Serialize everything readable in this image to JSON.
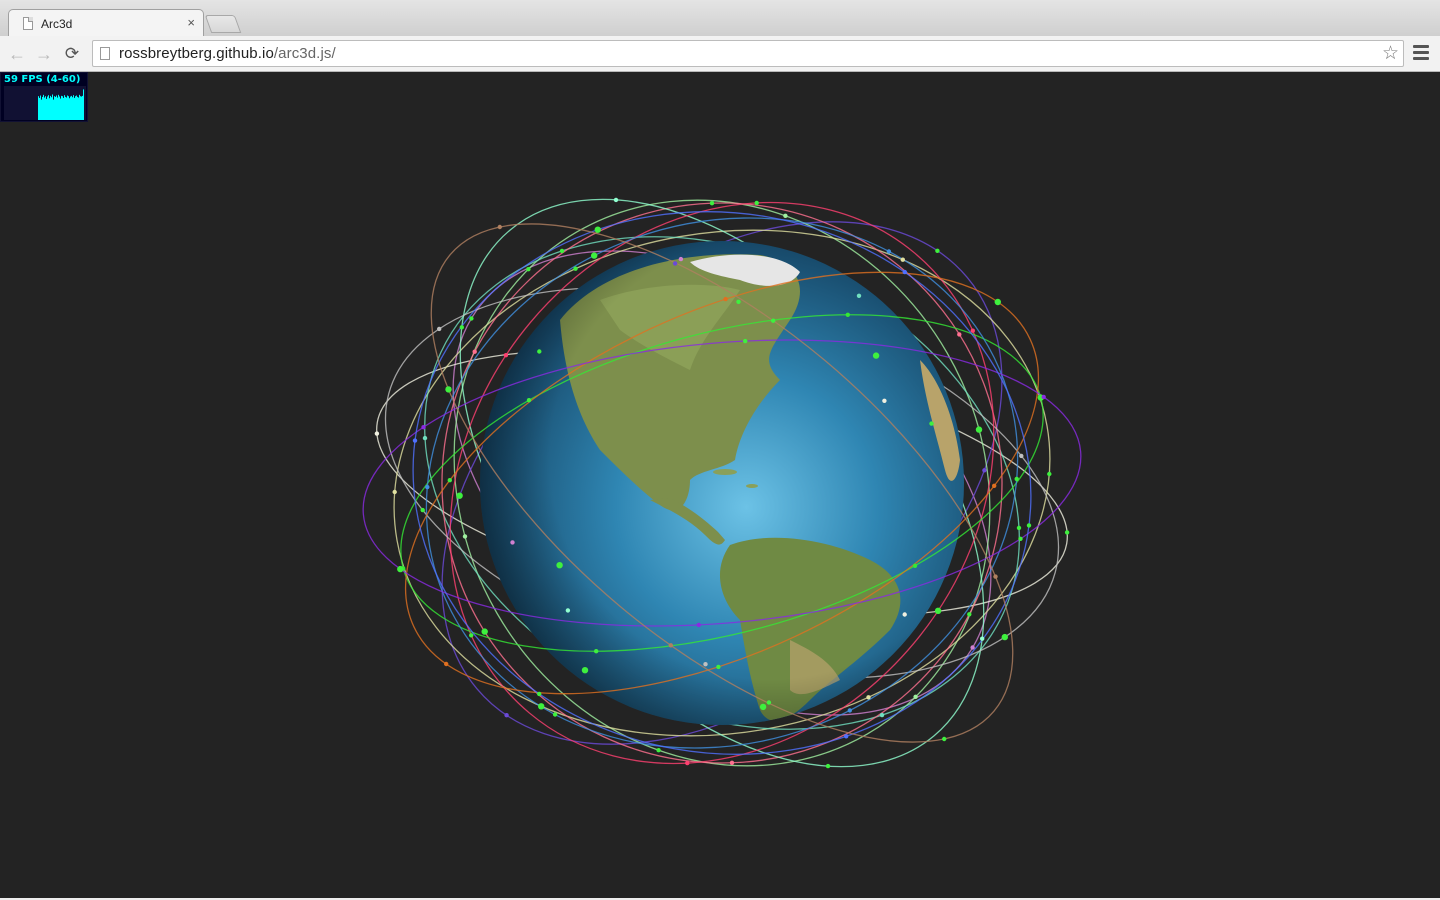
{
  "tab": {
    "title": "Arc3d",
    "close_label": "×",
    "icon": "document-icon"
  },
  "toolbar": {
    "back_label": "←",
    "forward_label": "→",
    "reload_label": "⟳",
    "url_host": "rossbreytberg.github.io",
    "url_path": "/arc3d.js/",
    "bookmark_label": "☆"
  },
  "stats": {
    "fps_text": "59 FPS (4-60)",
    "bars": [
      0.7,
      0.65,
      0.72,
      0.6,
      0.68,
      0.74,
      0.66,
      0.7,
      0.62,
      0.69,
      0.73,
      0.64,
      0.71,
      0.67,
      0.75,
      0.6,
      0.7,
      0.68,
      0.72,
      0.66,
      0.74,
      0.69,
      0.63,
      0.71,
      0.7,
      0.65,
      0.73,
      0.68,
      0.66,
      0.72,
      0.7,
      0.64,
      0.69,
      0.71,
      0.67,
      0.73,
      0.65,
      0.7,
      0.72,
      0.68,
      0.66,
      0.74,
      0.7,
      0.69,
      0.71,
      0.9
    ]
  },
  "scene": {
    "background": "#232323",
    "globe": {
      "ocean": "#2f7fa8",
      "ocean_light": "#5fb6de",
      "land": "#7a8f4a",
      "desert": "#b8a06a",
      "ice": "#e8e8e8"
    },
    "orbit_colors": [
      "#34e834",
      "#d080d0",
      "#f0f0e0",
      "#4090e0",
      "#6b4ad8",
      "#a0f0a0",
      "#e07020",
      "#e0e0a0",
      "#70e0c0",
      "#8a2be2",
      "#ff7090",
      "#90ffd0",
      "#5070ff",
      "#c0c0c0",
      "#ff4070",
      "#b08060"
    ]
  }
}
